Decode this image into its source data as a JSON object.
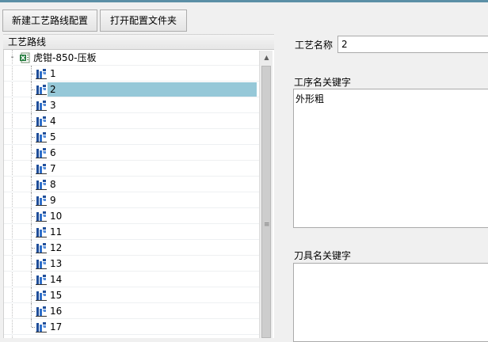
{
  "toolbar": {
    "new_route_label": "新建工艺路线配置",
    "open_folder_label": "打开配置文件夹"
  },
  "tree": {
    "header": "工艺路线",
    "root": {
      "label": "虎钳-850-压板",
      "expander": "-",
      "icon": "excel-file-icon"
    },
    "node_icon": "process-node-icon",
    "selected_index": 1,
    "items": [
      "1",
      "2",
      "3",
      "4",
      "5",
      "6",
      "7",
      "8",
      "9",
      "10",
      "11",
      "12",
      "13",
      "14",
      "15",
      "16",
      "17"
    ]
  },
  "form": {
    "process_name_label": "工艺名称",
    "process_name_value": "2",
    "operation_keyword_label": "工序名关键字",
    "operation_keyword_value": "外形粗",
    "tool_keyword_label": "刀具名关键字",
    "tool_keyword_value": ""
  },
  "colors": {
    "selection": "#96c8d8",
    "accent_bar": "#5b8fa6"
  }
}
